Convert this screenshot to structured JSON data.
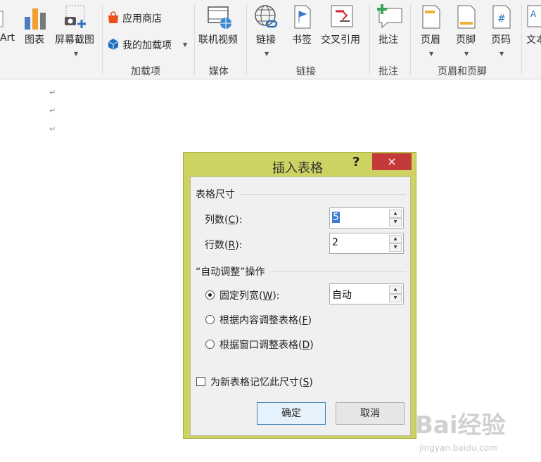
{
  "ribbon": {
    "smartart_label": "Art",
    "chart_label": "图表",
    "screenshot_label": "屏幕截图",
    "addins": {
      "store_label": "应用商店",
      "my_addins_label": "我的加载项",
      "group_label": "加载项"
    },
    "media": {
      "online_video_label": "联机视频",
      "group_label": "媒体"
    },
    "links": {
      "link_label": "链接",
      "bookmark_label": "书签",
      "cross_ref_label": "交叉引用",
      "group_label": "链接"
    },
    "comments": {
      "comment_label": "批注",
      "group_label": "批注"
    },
    "header_footer": {
      "header_label": "页眉",
      "footer_label": "页脚",
      "page_number_label": "页码",
      "group_label": "页眉和页脚"
    },
    "text_label": "文本"
  },
  "document": {
    "paragraph_mark": "↵"
  },
  "dialog": {
    "title": "插入表格",
    "help_label": "?",
    "close_label": "×",
    "table_size": {
      "section_title": "表格尺寸",
      "columns_label_pre": "列数(",
      "columns_key": "C",
      "columns_label_post": "):",
      "columns_value": "5",
      "rows_label_pre": "行数(",
      "rows_key": "R",
      "rows_label_post": "):",
      "rows_value": "2"
    },
    "autofit": {
      "section_title": "“自动调整”操作",
      "fixed_pre": "固定列宽(",
      "fixed_key": "W",
      "fixed_post": "):",
      "fixed_value": "自动",
      "content_pre": "根据内容调整表格(",
      "content_key": "F",
      "content_post": ")",
      "window_pre": "根据窗口调整表格(",
      "window_key": "D",
      "window_post": ")",
      "selected": "fixed"
    },
    "remember_pre": "为新表格记忆此尺寸(",
    "remember_key": "S",
    "remember_post": ")",
    "remember_checked": false,
    "ok_label": "确定",
    "cancel_label": "取消"
  },
  "watermark": {
    "brand": "Bai经验",
    "url": "jingyan.baidu.com"
  },
  "colors": {
    "title_bar": "#cdd262",
    "close_button": "#c43a3a",
    "selection": "#3b7bd6"
  }
}
